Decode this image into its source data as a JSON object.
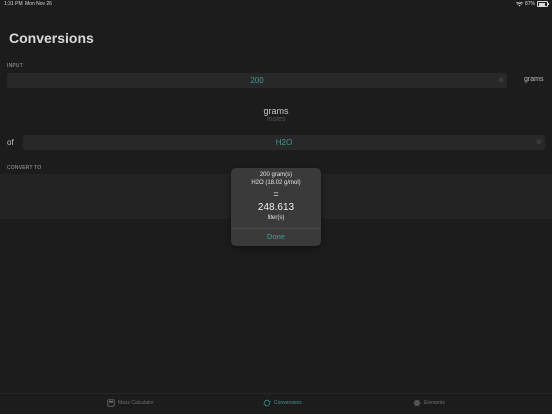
{
  "status": {
    "time": "1:31 PM",
    "date": "Mon Nov 26",
    "battery": "87%",
    "battery_level": 0.87
  },
  "page": {
    "title": "Conversions"
  },
  "input": {
    "label": "INPUT",
    "value": "200",
    "unit": "grams"
  },
  "unit_picker": {
    "selected": "grams",
    "next": "moles"
  },
  "substance": {
    "prefix": "of",
    "value": "H2O"
  },
  "convert_to": {
    "label": "CONVERT TO"
  },
  "dialog": {
    "line1": "200 gram(s)",
    "line2": "H2O (18.02 g/mol)",
    "equals": "=",
    "result": "248.613",
    "result_unit": "liter(s)",
    "done": "Done"
  },
  "tabs": [
    {
      "label": "Mass Calculator",
      "icon": "calculator-icon"
    },
    {
      "label": "Conversions",
      "icon": "refresh-icon",
      "active": true
    },
    {
      "label": "Elements",
      "icon": "atom-icon"
    }
  ],
  "colors": {
    "accent": "#3f9a93",
    "background": "#1c1c1c"
  }
}
